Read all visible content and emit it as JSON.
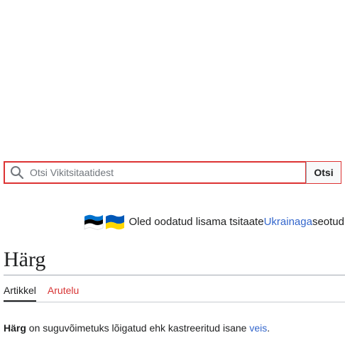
{
  "search": {
    "placeholder": "Otsi Vikitsitaatidest",
    "button_label": "Otsi"
  },
  "banner": {
    "flags": [
      "estonia-flag-icon",
      "ukraine-flag-icon"
    ],
    "text_before": "Oled oodatud lisama tsitaate ",
    "link_text": "Ukrainaga",
    "text_after": " seotud"
  },
  "page": {
    "title": "Härg",
    "tabs": [
      {
        "label": "Artikkel",
        "active": true
      },
      {
        "label": "Arutelu",
        "active": false
      }
    ],
    "intro": {
      "bold_term": "Härg",
      "text": " on suguvõimetuks lõigatud ehk kastreeritud isane ",
      "link_text": "veis",
      "end": "."
    }
  },
  "colors": {
    "link": "#3366cc",
    "new_link": "#d73333",
    "search_border": "#dd3333",
    "estonia": [
      "#0072ce",
      "#000000",
      "#ffffff"
    ],
    "ukraine": [
      "#0057b7",
      "#ffd700"
    ]
  }
}
